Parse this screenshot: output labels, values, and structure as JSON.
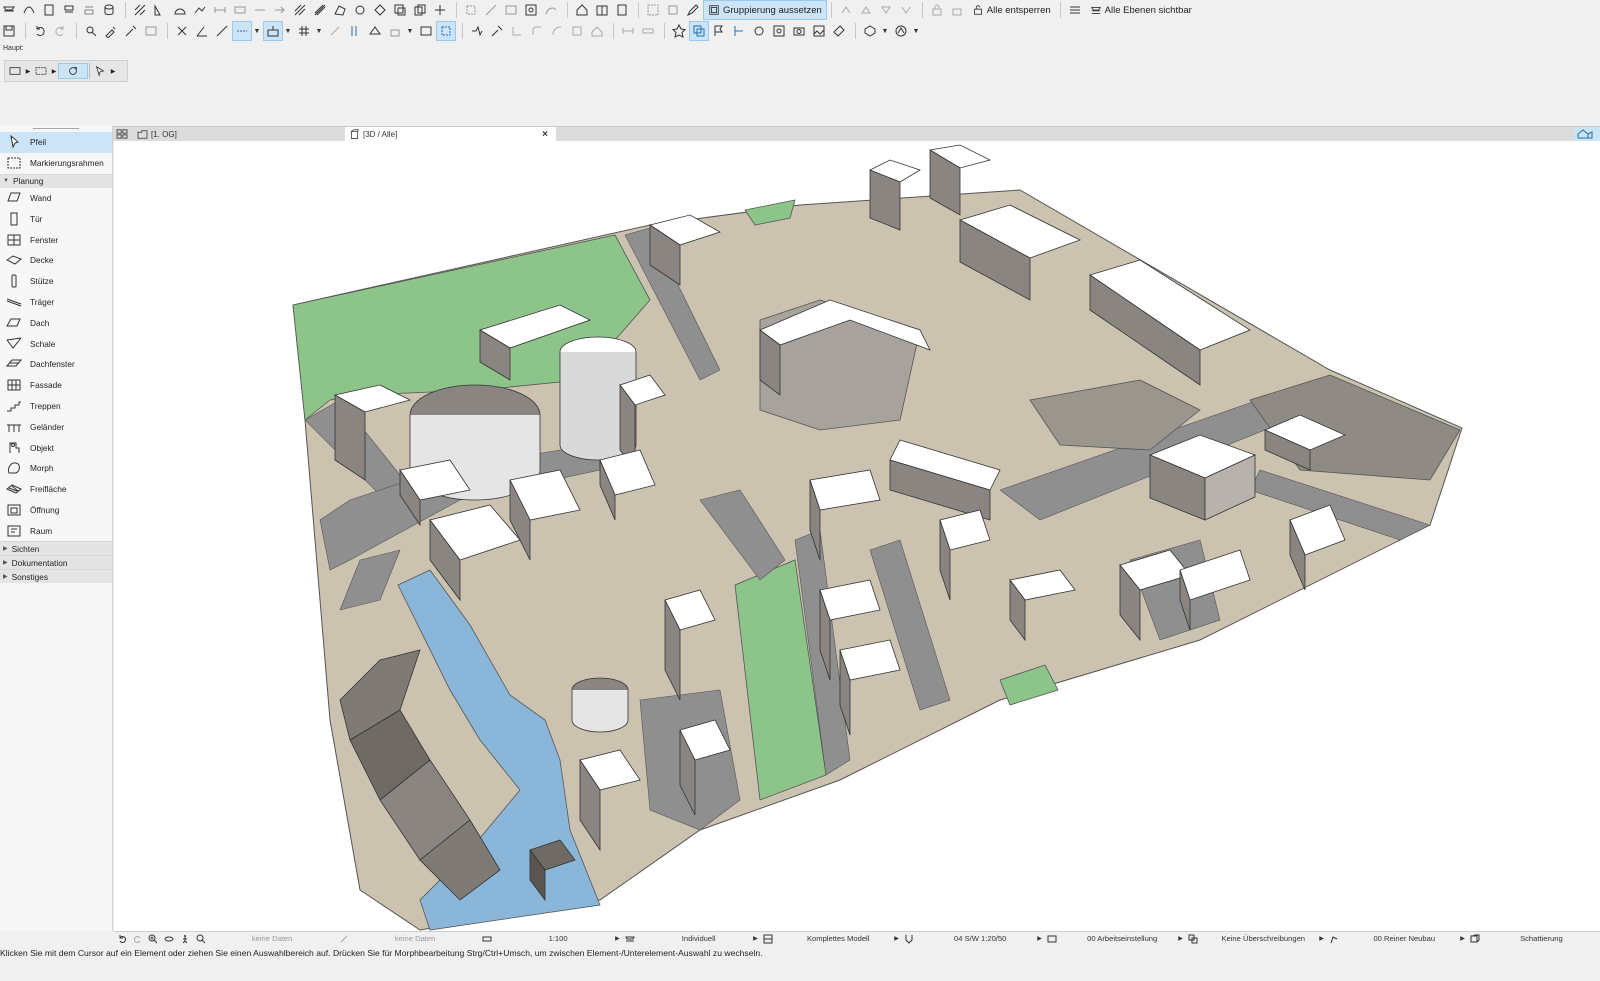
{
  "toolbar": {
    "group_suspend_label": "Gruppierung aussetzen",
    "unlock_all_label": "Alle entsperren",
    "all_layers_visible_label": "Alle Ebenen sichtbar",
    "haupt_label": "Haupt:"
  },
  "tabs": [
    {
      "label": "[1. OG]"
    },
    {
      "label": "[3D / Alle]",
      "close": "×"
    }
  ],
  "palette": {
    "top_items": [
      {
        "label": "Pfeil",
        "icon": "arrow-pointer-icon",
        "selected": true
      },
      {
        "label": "Markierungsrahmen",
        "icon": "marquee-icon"
      }
    ],
    "planung_header": "Planung",
    "planung_items": [
      {
        "label": "Wand",
        "icon": "wall-icon"
      },
      {
        "label": "Tür",
        "icon": "door-icon"
      },
      {
        "label": "Fenster",
        "icon": "window-icon"
      },
      {
        "label": "Decke",
        "icon": "slab-icon"
      },
      {
        "label": "Stütze",
        "icon": "column-icon"
      },
      {
        "label": "Träger",
        "icon": "beam-icon"
      },
      {
        "label": "Dach",
        "icon": "roof-icon"
      },
      {
        "label": "Schale",
        "icon": "shell-icon"
      },
      {
        "label": "Dachfenster",
        "icon": "skylight-icon"
      },
      {
        "label": "Fassade",
        "icon": "curtain-wall-icon"
      },
      {
        "label": "Treppen",
        "icon": "stair-icon"
      },
      {
        "label": "Geländer",
        "icon": "railing-icon"
      },
      {
        "label": "Objekt",
        "icon": "object-icon"
      },
      {
        "label": "Morph",
        "icon": "morph-icon"
      },
      {
        "label": "Freifläche",
        "icon": "mesh-icon"
      },
      {
        "label": "Öffnung",
        "icon": "opening-icon"
      },
      {
        "label": "Raum",
        "icon": "zone-icon"
      }
    ],
    "collapsed_groups": [
      "Sichten",
      "Dokumentation",
      "Sonstiges"
    ]
  },
  "viewbar": {
    "field1": "keine Daten",
    "field2": "keine Daten",
    "scale": "1:100",
    "layer_combo": "Individuell",
    "model_view": "Komplettes Modell",
    "pen_set": "04 S/W 1:20/50",
    "model_view_option": "00 Arbeitseinstellung",
    "overrides": "Keine Überschreibungen",
    "renovation": "00 Reiner Neubau",
    "shading": "Schattierung"
  },
  "status": {
    "message": "Klicken Sie mit dem Cursor auf ein Element oder ziehen Sie einen Auswahlbereich auf. Drücken Sie für Morphbearbeitung Strg/Ctrl+Umsch, um zwischen Element-/Unterelement-Auswahl zu wechseln."
  },
  "colors": {
    "accent": "#cce4f7",
    "ground": "#cbc3b0",
    "street": "#8f8f8f",
    "green": "#8cc48a",
    "water": "#8ab6d9",
    "building_top": "#ffffff",
    "building_side": "#8a8580"
  }
}
